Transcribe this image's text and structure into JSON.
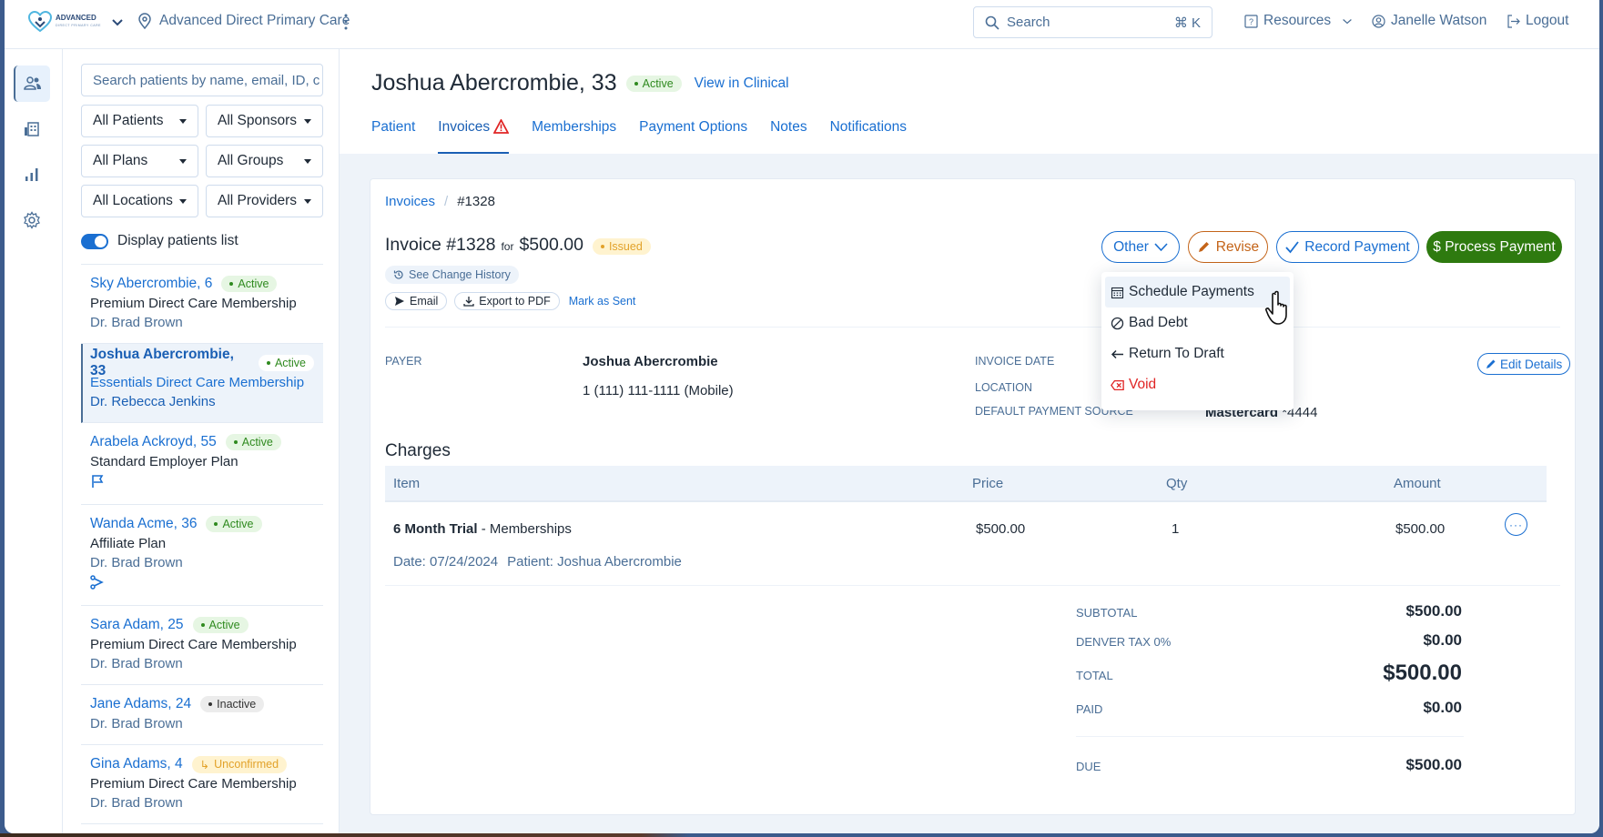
{
  "topbar": {
    "brand": "ADVANCED",
    "brand_sub": "DIRECT PRIMARY CARE",
    "organization": "Advanced Direct Primary Care",
    "search_placeholder": "Search",
    "search_shortcut": "⌘ K",
    "resources_label": "Resources",
    "user_name": "Janelle Watson",
    "logout_label": "Logout"
  },
  "rail": [
    "patients",
    "organization",
    "reports",
    "settings"
  ],
  "patients_panel": {
    "search_placeholder": "Search patients by name, email, ID, c",
    "filters": [
      "All Patients",
      "All Sponsors",
      "All Plans",
      "All Groups",
      "All Locations",
      "All Providers"
    ],
    "display_toggle_label": "Display patients list",
    "display_toggle_on": true,
    "patients": [
      {
        "name": "Sky Abercrombie, 6",
        "status": "Active",
        "plan": "Premium Direct Care Membership",
        "doctor": "Dr. Brad Brown",
        "icon": ""
      },
      {
        "name": "Joshua Abercrombie, 33",
        "status": "Active",
        "plan": "Essentials Direct Care Membership",
        "doctor": "Dr. Rebecca Jenkins",
        "icon": "",
        "selected": true
      },
      {
        "name": "Arabela Ackroyd, 55",
        "status": "Active",
        "plan": "Standard Employer Plan",
        "doctor": "",
        "icon": "flag-icon"
      },
      {
        "name": "Wanda Acme, 36",
        "status": "Active",
        "plan": "Affiliate Plan",
        "doctor": "Dr. Brad Brown",
        "icon": "share-icon"
      },
      {
        "name": "Sara Adam, 25",
        "status": "Active",
        "plan": "Premium Direct Care Membership",
        "doctor": "Dr. Brad Brown",
        "icon": ""
      },
      {
        "name": "Jane Adams, 24",
        "status": "Inactive",
        "plan": "",
        "doctor": "Dr. Brad Brown",
        "icon": ""
      },
      {
        "name": "Gina Adams, 4",
        "status": "Unconfirmed",
        "plan": "Premium Direct Care Membership",
        "doctor": "Dr. Brad Brown",
        "icon": ""
      }
    ]
  },
  "patient_header": {
    "name": "Joshua Abercrombie, 33",
    "status": "Active",
    "view_link": "View in Clinical",
    "tabs": [
      "Patient",
      "Invoices",
      "Memberships",
      "Payment Options",
      "Notes",
      "Notifications"
    ],
    "active_tab": "Invoices"
  },
  "invoice": {
    "breadcrumb": [
      "Invoices",
      "/",
      "#1328"
    ],
    "title": "Invoice #1328",
    "for_label": "for",
    "amount": "$500.00",
    "status": "Issued",
    "change_history": "See Change History",
    "email_label": "Email",
    "export_label": "Export to PDF",
    "mark_sent_label": "Mark as Sent",
    "buttons": {
      "other": "Other",
      "revise": "Revise",
      "record_payment": "Record Payment",
      "process_payment": "$ Process Payment"
    },
    "other_menu": [
      "Schedule Payments",
      "Bad Debt",
      "Return To Draft",
      "Void"
    ],
    "payer_label": "PAYER",
    "payer_name": "Joshua Abercrombie",
    "payer_phone": "1 (111) 111-1111 (Mobile)",
    "invoice_date_label": "INVOICE DATE",
    "location_label": "LOCATION",
    "payment_source_label": "DEFAULT PAYMENT SOURCE",
    "payment_source_brand": "Mastercard",
    "payment_source_last4": "*4444",
    "edit_details": "Edit Details",
    "charges_title": "Charges",
    "columns": [
      "Item",
      "Price",
      "Qty",
      "Amount"
    ],
    "charges": [
      {
        "name": "6 Month Trial",
        "category": "- Memberships",
        "price": "$500.00",
        "qty": "1",
        "amount": "$500.00",
        "date": "Date: 07/24/2024",
        "patient": "Patient: Joshua Abercrombie"
      }
    ],
    "totals": {
      "subtotal_label": "SUBTOTAL",
      "subtotal": "$500.00",
      "tax_label": "DENVER TAX 0%",
      "tax": "$0.00",
      "total_label": "TOTAL",
      "total": "$500.00",
      "paid_label": "PAID",
      "paid": "$0.00",
      "due_label": "DUE",
      "due": "$500.00"
    }
  },
  "colors": {
    "accent": "#1a6fd1",
    "success": "#2e7a0f",
    "warning": "#c46419",
    "danger": "#e02424"
  }
}
